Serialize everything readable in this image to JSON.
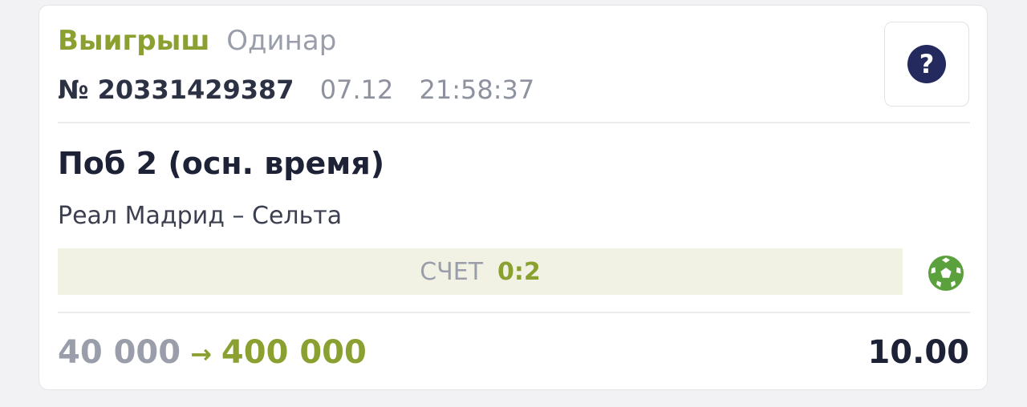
{
  "bet": {
    "status": "Выигрыш",
    "type": "Одинар",
    "number": "№ 20331429387",
    "date": "07.12",
    "time": "21:58:37"
  },
  "help": {
    "label": "?"
  },
  "selection": {
    "market": "Поб 2 (осн. время)",
    "event": "Реал Мадрид – Сельта",
    "score_label": "СЧЕТ",
    "score": "0:2",
    "sport_icon": "soccer-ball-icon"
  },
  "summary": {
    "stake": "40 000",
    "arrow": "→",
    "payout": "400 000",
    "odds": "10.00"
  },
  "colors": {
    "win_green": "#8aa131",
    "muted_gray": "#9a9eab",
    "dark_text": "#1d2237",
    "help_navy": "#242a5d",
    "score_bg": "#f1f2e4",
    "soccer_green": "#5aa03c"
  }
}
